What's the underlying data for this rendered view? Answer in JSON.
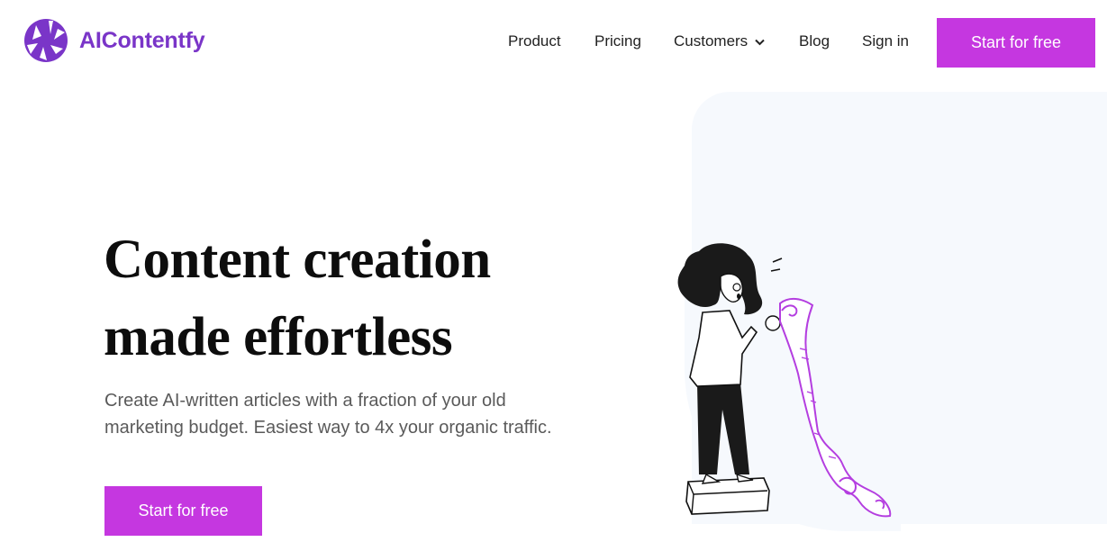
{
  "brand": {
    "name": "AIContentfy",
    "accent": "#7a35c8",
    "cta_color": "#c537e0"
  },
  "nav": {
    "items": [
      {
        "label": "Product"
      },
      {
        "label": "Pricing"
      },
      {
        "label": "Customers",
        "icon": "chevron-down-icon"
      },
      {
        "label": "Blog"
      },
      {
        "label": "Sign in"
      }
    ],
    "cta_label": "Start for free"
  },
  "hero": {
    "title_line1": "Content creation",
    "title_line2": "made effortless",
    "subtitle": "Create AI-written articles with a fraction of your old marketing budget. Easiest way to 4x your organic traffic.",
    "cta_label": "Start for free"
  },
  "illustration": {
    "icon": "woman-reading-scroll-illustration"
  }
}
